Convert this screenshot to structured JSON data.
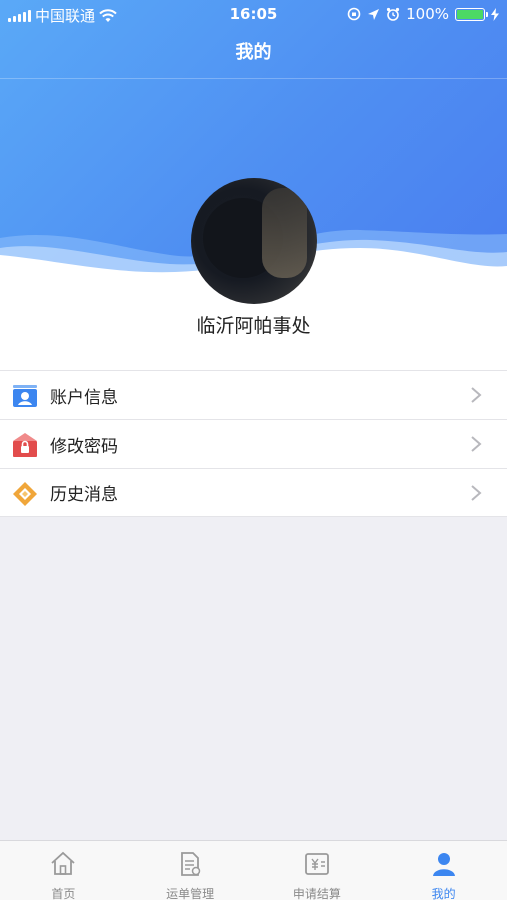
{
  "status_bar": {
    "carrier": "中国联通",
    "time": "16:05",
    "battery": "100%",
    "battery_level": 1.0
  },
  "nav": {
    "title": "我的"
  },
  "profile": {
    "name": "临沂阿帕事处"
  },
  "menu": [
    {
      "label": "账户信息",
      "icon": "account-card-icon",
      "color": "#3c86f0"
    },
    {
      "label": "修改密码",
      "icon": "lock-house-icon",
      "color": "#e24c4c"
    },
    {
      "label": "历史消息",
      "icon": "diamond-message-icon",
      "color": "#f0a63a"
    }
  ],
  "tabs": [
    {
      "label": "首页",
      "icon": "home-icon",
      "active": false
    },
    {
      "label": "运单管理",
      "icon": "document-icon",
      "active": false
    },
    {
      "label": "申请结算",
      "icon": "yen-receipt-icon",
      "active": false
    },
    {
      "label": "我的",
      "icon": "person-icon",
      "active": true
    }
  ],
  "colors": {
    "accent": "#3c86f0",
    "header_gradient_start": "#5aa9f7",
    "header_gradient_end": "#4a7ef0",
    "background": "#efeff4"
  }
}
